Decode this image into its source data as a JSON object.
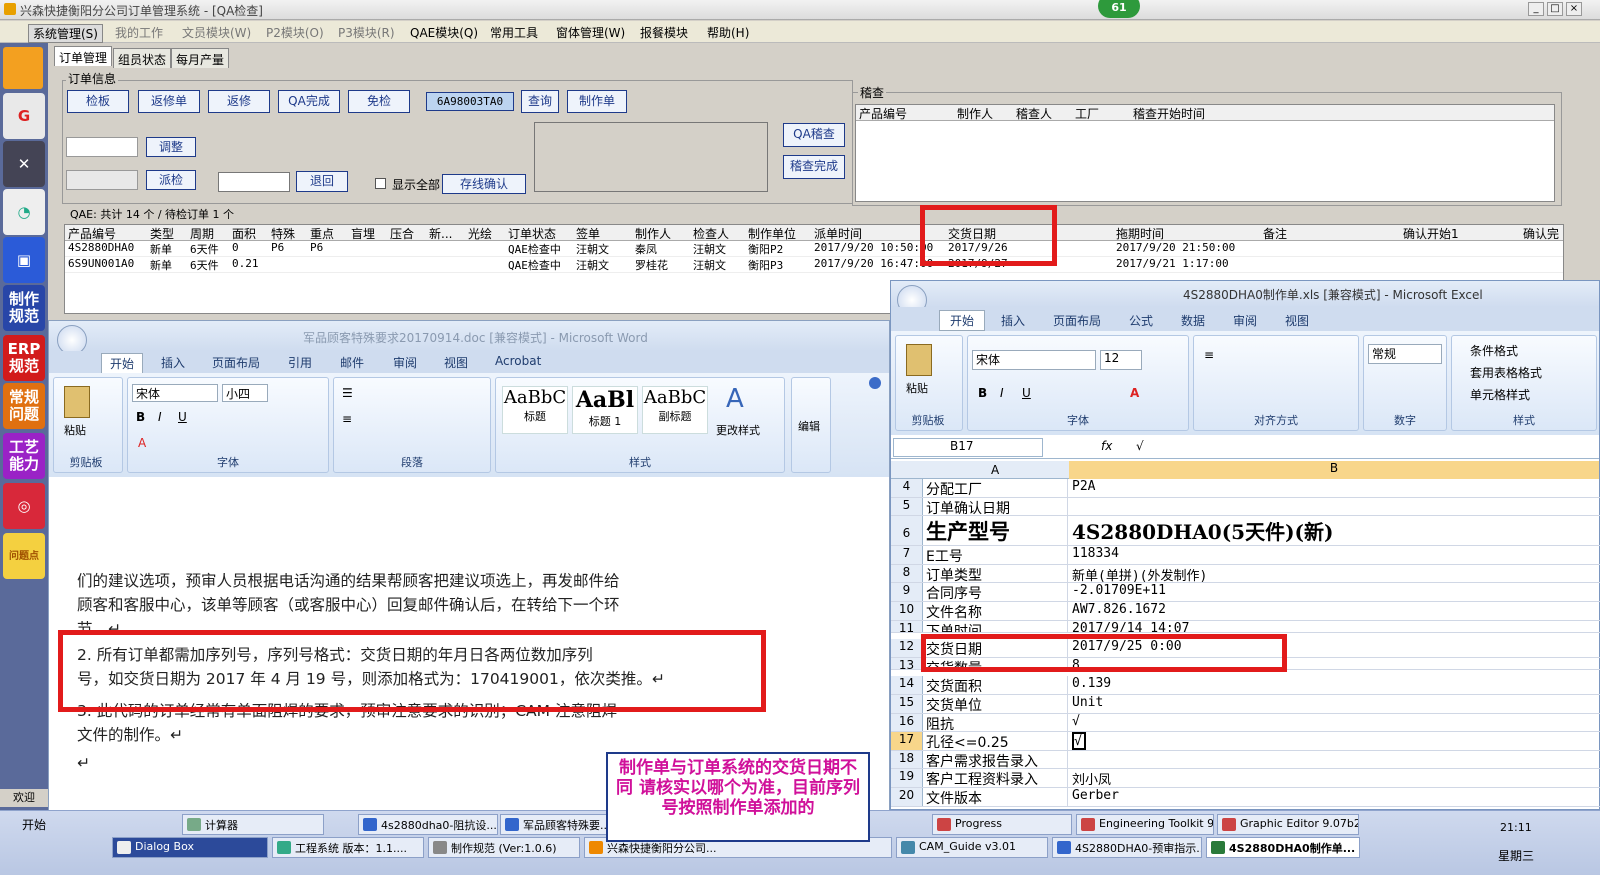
{
  "app": {
    "title": "兴森快捷衡阳分公司订单管理系统 - [QA检查]",
    "badge": "61"
  },
  "menu": [
    "系统管理(S)",
    "我的工作",
    "文员模块(W)",
    "P2模块(O)",
    "P3模块(R)",
    "QAE模块(Q)",
    "常用工具",
    "窗体管理(W)",
    "报餐模块",
    "帮助(H)"
  ],
  "sidebar": {
    "items": [
      "制作\n规范",
      "ERP\n规范",
      "常规\n问题",
      "工艺\n能力",
      "问题点"
    ],
    "welcome": "欢迎"
  },
  "tabs": [
    "订单管理",
    "组员状态",
    "每月产量"
  ],
  "order_info": {
    "legend": "订单信息",
    "buttons": [
      "检板",
      "返修单",
      "返修",
      "QA完成",
      "免检"
    ],
    "code": "6A98003TA0",
    "query": "查询",
    "make_sheet": "制作单",
    "adjust": "调整",
    "dispatch": "派检",
    "return": "退回",
    "show_all": "显示全部",
    "online_confirm": "存线确认",
    "qa_review": "QA稽查",
    "review_done": "稽查完成"
  },
  "audit": {
    "legend": "稽查",
    "columns": [
      "产品编号",
      "制作人",
      "稽查人",
      "工厂",
      "稽查开始时间"
    ]
  },
  "qae": {
    "label": "QAE: 共计 14 个 / 待检订单 1 个",
    "columns": [
      "产品编号",
      "类型",
      "周期",
      "面积",
      "特殊",
      "重点",
      "盲埋",
      "压合",
      "新...",
      "光绘",
      "订单状态",
      "签单",
      "制作人",
      "检查人",
      "制作单位",
      "派单时间",
      "交货日期",
      "拖期时间",
      "备注",
      "确认开始1",
      "确认完"
    ],
    "rows": [
      [
        "4S2880DHA0",
        "新单",
        "6天件",
        "0",
        "P6",
        "P6",
        "",
        "",
        "",
        "",
        "QAE检查中",
        "汪朝文",
        "秦凤",
        "汪朝文",
        "衡阳P2",
        "2017/9/20 10:50:00",
        "2017/9/26",
        "2017/9/20 21:50:00",
        "",
        "",
        ""
      ],
      [
        "6S9UN001A0",
        "新单",
        "6天件",
        "0.21",
        "",
        "",
        "",
        "",
        "",
        "",
        "QAE检查中",
        "汪朝文",
        "罗桂花",
        "汪朝文",
        "衡阳P3",
        "2017/9/20 16:47:00",
        "2017/9/27",
        "2017/9/21 1:17:00",
        "",
        "",
        ""
      ]
    ]
  },
  "word": {
    "title": "军品顾客特殊要求20170914.doc [兼容模式] - Microsoft Word",
    "tabs": [
      "开始",
      "插入",
      "页面布局",
      "引用",
      "邮件",
      "审阅",
      "视图",
      "Acrobat"
    ],
    "font": "宋体",
    "size": "小四",
    "styles": [
      "AaBbC",
      "AaBl",
      "AaBbC"
    ],
    "style_names": [
      "标题",
      "标题 1",
      "副标题"
    ],
    "change_style": "更改样式",
    "edit": "编辑",
    "groups": [
      "剪贴板",
      "字体",
      "段落",
      "样式"
    ],
    "paste": "粘贴",
    "paragraphs": [
      "们的建议选项，预审人员根据电话沟通的结果帮顾客把建议项选上，再发邮件给",
      "顾客和客服中心，该单等顾客（或客服中心）回复邮件确认后，在转给下一个环",
      "节。↵",
      "2.  所有订单都需加序列号，序列号格式：交货日期的年月日各两位数加序列",
      "号，如交货日期为 2017 年 4 月 19 号，则添加格式为：170419001，依次类推。↵",
      "3.  此代码的订单经常有单面阻焊的要求，预审注意要求的识别；CAM 注意阻焊",
      "文件的制作。↵",
      "↵"
    ]
  },
  "excel": {
    "title": "4S2880DHA0制作单.xls  [兼容模式] - Microsoft Excel",
    "tabs": [
      "开始",
      "插入",
      "页面布局",
      "公式",
      "数据",
      "审阅",
      "视图"
    ],
    "font": "宋体",
    "size": "12",
    "numfmt": "常规",
    "groups": [
      "剪贴板",
      "字体",
      "对齐方式",
      "数字",
      "样式"
    ],
    "styles": [
      "条件格式",
      "套用表格格式",
      "单元格样式"
    ],
    "paste": "粘贴",
    "cellref": "B17",
    "formula": "√",
    "col_a": "A",
    "col_b": "B",
    "rows": [
      [
        "4",
        "分配工厂",
        "P2A"
      ],
      [
        "5",
        "订单确认日期",
        ""
      ],
      [
        "6",
        "生产型号",
        "4S2880DHA0(5天件)(新)"
      ],
      [
        "7",
        "E工号",
        "118334"
      ],
      [
        "8",
        "订单类型",
        "新单(单拼)(外发制作)"
      ],
      [
        "9",
        "合同序号",
        "-2.01709E+11"
      ],
      [
        "10",
        "文件名称",
        "AW7.826.1672"
      ],
      [
        "11",
        "下单时间",
        "2017/9/14 14:07"
      ],
      [
        "12",
        "交货日期",
        "2017/9/25 0:00"
      ],
      [
        "13",
        "交货数量",
        "8"
      ],
      [
        "14",
        "交货面积",
        "0.139"
      ],
      [
        "15",
        "交货单位",
        "Unit"
      ],
      [
        "16",
        "阻抗",
        "√"
      ],
      [
        "17",
        "孔径<=0.25",
        "√"
      ],
      [
        "18",
        "客户需求报告录入",
        ""
      ],
      [
        "19",
        "客户工程资料录入",
        "刘小凤"
      ],
      [
        "20",
        "文件版本",
        "Gerber"
      ]
    ]
  },
  "note": "制作单与订单系统的交货日期不同  请核实以哪个为准，目前序列号按照制作单添加的",
  "taskbar": {
    "start": "开始",
    "row1": [
      "计算器",
      "4s2880dha0-阻抗设...",
      "军品顾客特殊要...",
      "Progress",
      "Engineering Toolkit 9....",
      "Graphic Editor 9.07b2..."
    ],
    "row2": [
      "Dialog Box",
      "工程系统 版本：1.1....",
      "制作规范 (Ver:1.0.6)",
      "兴森快捷衡阳分公司...",
      "CAM_Guide v3.01",
      "4S2880DHA0-预审指示...",
      "4S2880DHA0制作单..."
    ],
    "time": "21:11",
    "day": "星期三"
  },
  "colors": {
    "accent": "#1e3a8a",
    "highlight": "#e21b1b",
    "note_text": "#d0109a"
  }
}
